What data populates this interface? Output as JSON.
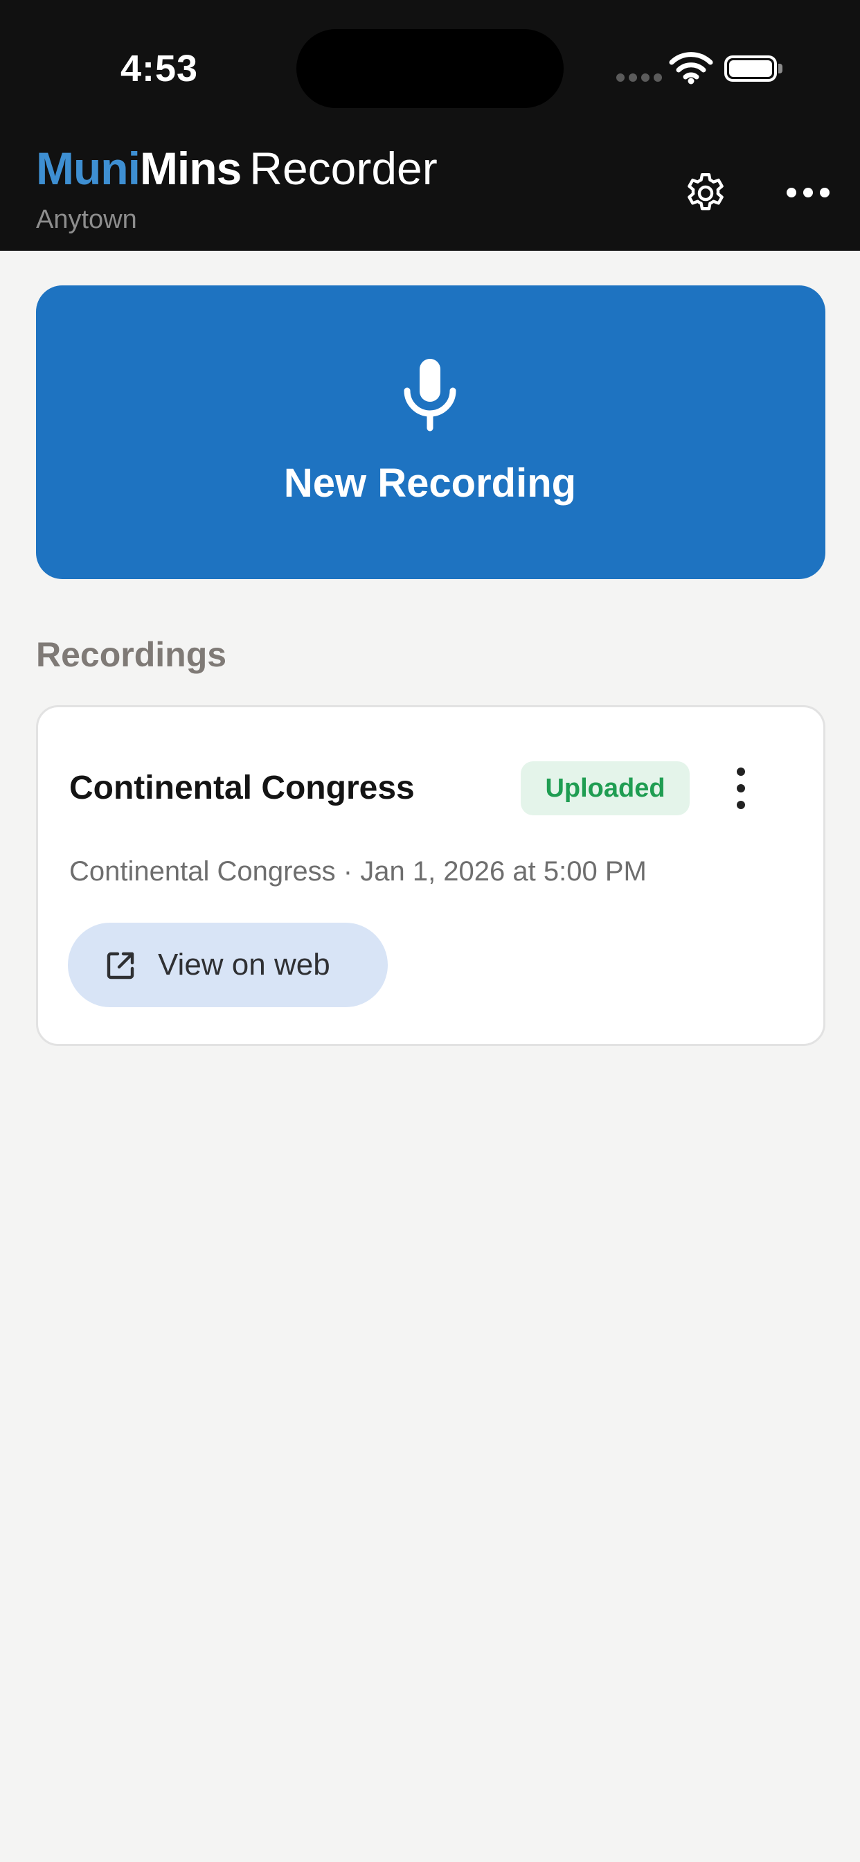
{
  "status_bar": {
    "time": "4:53"
  },
  "header": {
    "brand_primary": "Muni",
    "brand_secondary": "Mins",
    "product": "Recorder",
    "location": "Anytown",
    "settings_icon": "gear-icon",
    "more_icon": "ellipsis-icon"
  },
  "new_recording": {
    "label": "New Recording",
    "icon": "microphone-icon"
  },
  "recordings": {
    "section_title": "Recordings",
    "items": [
      {
        "title": "Continental Congress",
        "status": "Uploaded",
        "meta": "Continental Congress · Jan 1, 2026 at 5:00 PM",
        "action_label": "View on web",
        "action_icon": "external-link-icon"
      }
    ]
  },
  "colors": {
    "brand_blue": "#3e8fd2",
    "primary_button": "#1e73c1",
    "status_green": "#1f9d52",
    "badge_bg": "#e4f4ea",
    "secondary_button_bg": "#d8e4f6",
    "header_bg": "#111111",
    "page_bg": "#f4f4f3"
  }
}
